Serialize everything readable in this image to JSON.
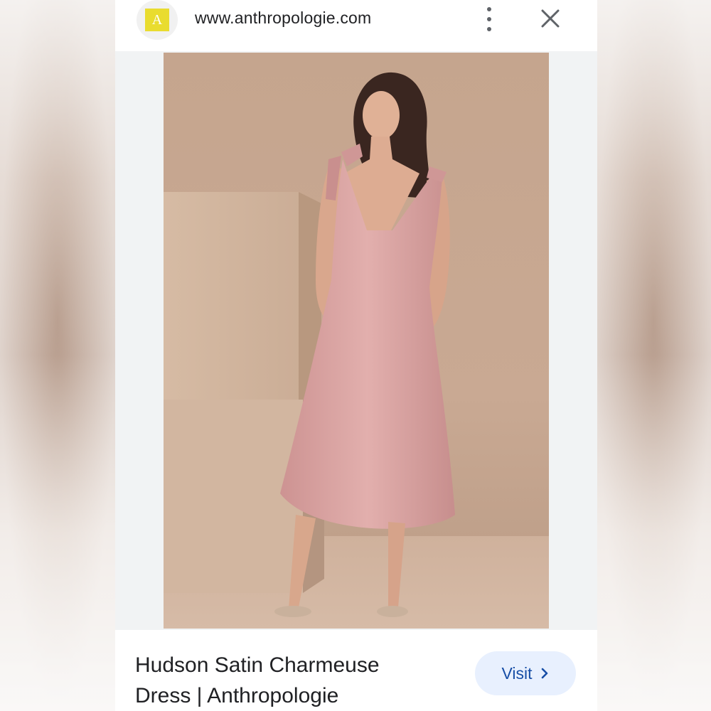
{
  "browser": {
    "favicon_letter": "A",
    "url": "www.anthropologie.com"
  },
  "image": {
    "alt": "Hudson Satin Charmeuse Dress | Anthropologie"
  },
  "result": {
    "title_line1": "Hudson Satin Charmeuse",
    "title_line2": "Dress | Anthropologie",
    "visit_label": "Visit"
  },
  "icons": {
    "menu": "more-vert-icon",
    "close": "close-icon",
    "chevron": "chevron-right-icon"
  },
  "colors": {
    "favicon_bg": "#e9dc2f",
    "visit_bg": "#e8f0fe",
    "visit_text": "#174ea6",
    "dress": "#d9a3a2",
    "backdrop": "#c7a78f"
  }
}
